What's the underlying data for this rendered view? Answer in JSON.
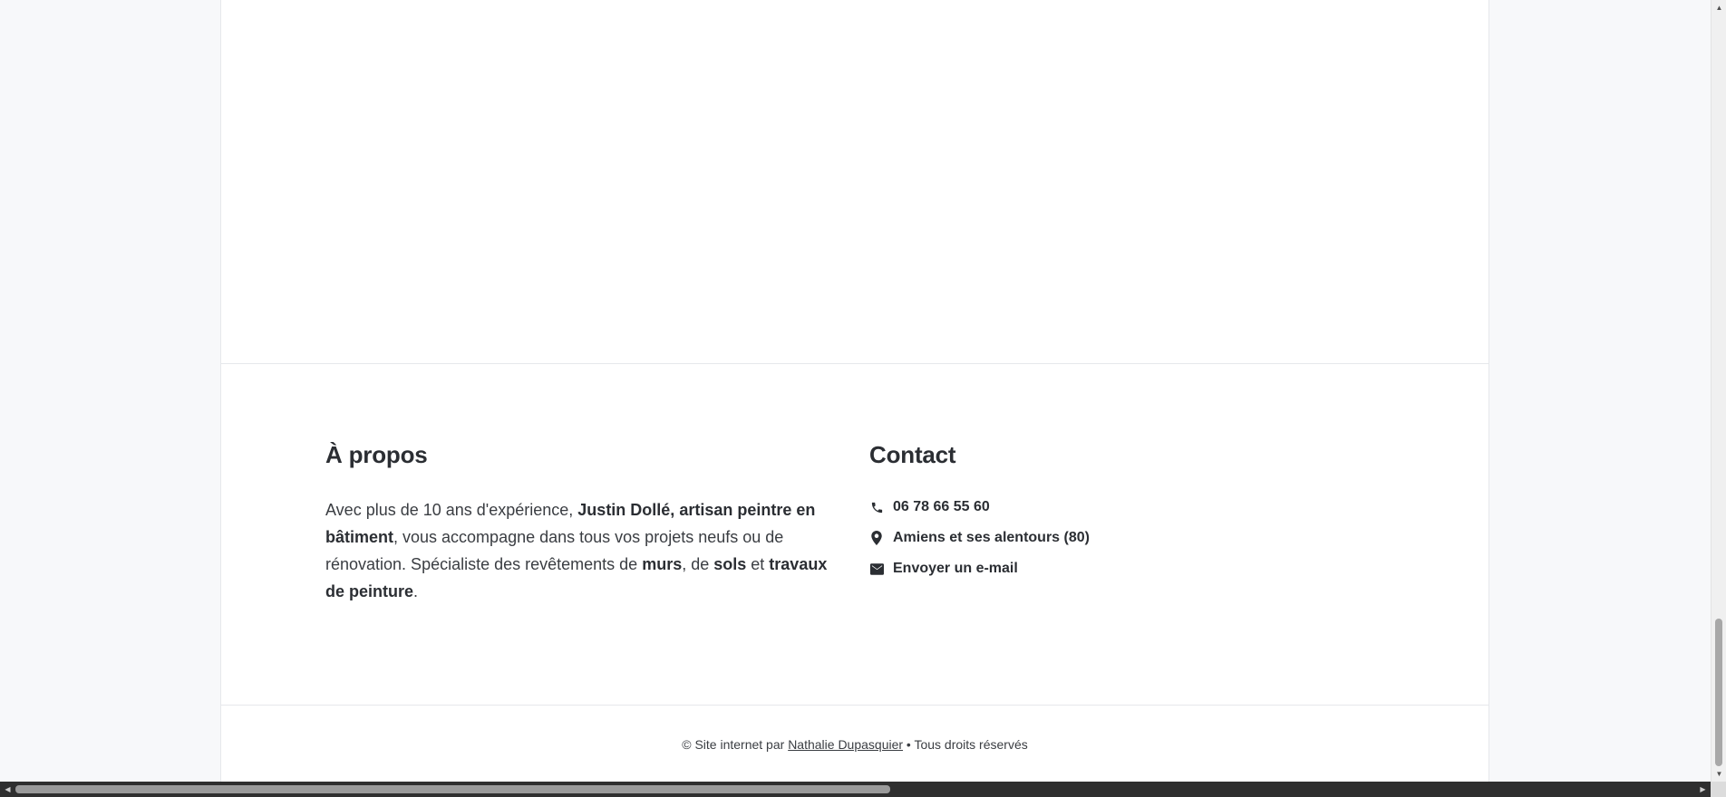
{
  "about": {
    "title": "À propos",
    "text_1": "Avec plus de 10 ans d'expérience, ",
    "bold_1": "Justin Dollé, artisan peintre en bâtiment",
    "text_2": ", vous accompagne dans tous vos projets neufs ou de rénovation. Spécialiste des revêtements de ",
    "bold_2": "murs",
    "text_3": ", de ",
    "bold_3": "sols",
    "text_4": " et ",
    "bold_4": "travaux de peinture",
    "text_5": "."
  },
  "contact": {
    "title": "Contact",
    "items": [
      {
        "icon": "phone-icon",
        "label": "06 78 66 55 60"
      },
      {
        "icon": "map-pin-icon",
        "label": "Amiens et ses alentours (80)"
      },
      {
        "icon": "envelope-icon",
        "label": "Envoyer un e-mail"
      }
    ]
  },
  "footer": {
    "prefix": "© Site internet par ",
    "author_link": "Nathalie Dupasquier",
    "suffix": " • Tous droits réservés"
  },
  "scrollbars": {
    "vertical_arrow_up": "▲",
    "vertical_arrow_down": "▼",
    "horizontal_arrow_left": "◀",
    "horizontal_arrow_right": "▶"
  }
}
